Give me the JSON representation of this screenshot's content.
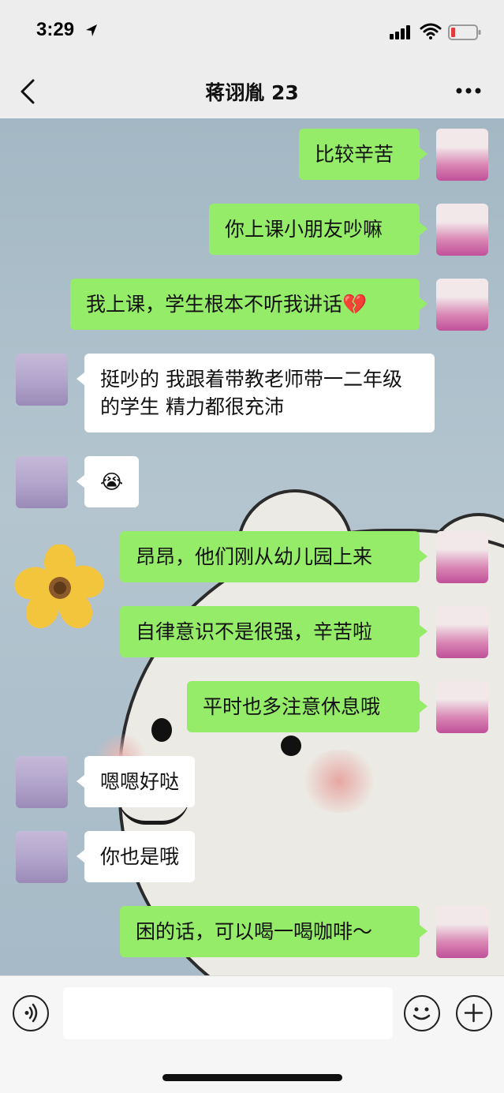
{
  "status_bar": {
    "time": "3:29"
  },
  "header": {
    "title": "蒋诩胤 23",
    "back_icon": "chevron-left-icon",
    "more_icon": "ellipsis-icon"
  },
  "messages": [
    {
      "sender": "me",
      "text": "比较辛苦"
    },
    {
      "sender": "me",
      "text": "你上课小朋友吵嘛"
    },
    {
      "sender": "me",
      "text": "我上课，学生根本不听我讲话💔"
    },
    {
      "sender": "other",
      "text": "挺吵的 我跟着带教老师带一二年级的学生 精力都很充沛"
    },
    {
      "sender": "other",
      "text": "😭"
    },
    {
      "sender": "me",
      "text": "昂昂，他们刚从幼儿园上来"
    },
    {
      "sender": "me",
      "text": "自律意识不是很强，辛苦啦"
    },
    {
      "sender": "me",
      "text": "平时也多注意休息哦"
    },
    {
      "sender": "other",
      "text": "嗯嗯好哒"
    },
    {
      "sender": "other",
      "text": "你也是哦"
    },
    {
      "sender": "me",
      "text": "困的话，可以喝一喝咖啡～"
    }
  ],
  "input_bar": {
    "voice_icon": "voice-icon",
    "emoji_icon": "emoji-icon",
    "plus_icon": "plus-icon",
    "text_value": ""
  },
  "colors": {
    "my_bubble": "#95ec69",
    "other_bubble": "#ffffff",
    "chrome": "#ededed"
  }
}
